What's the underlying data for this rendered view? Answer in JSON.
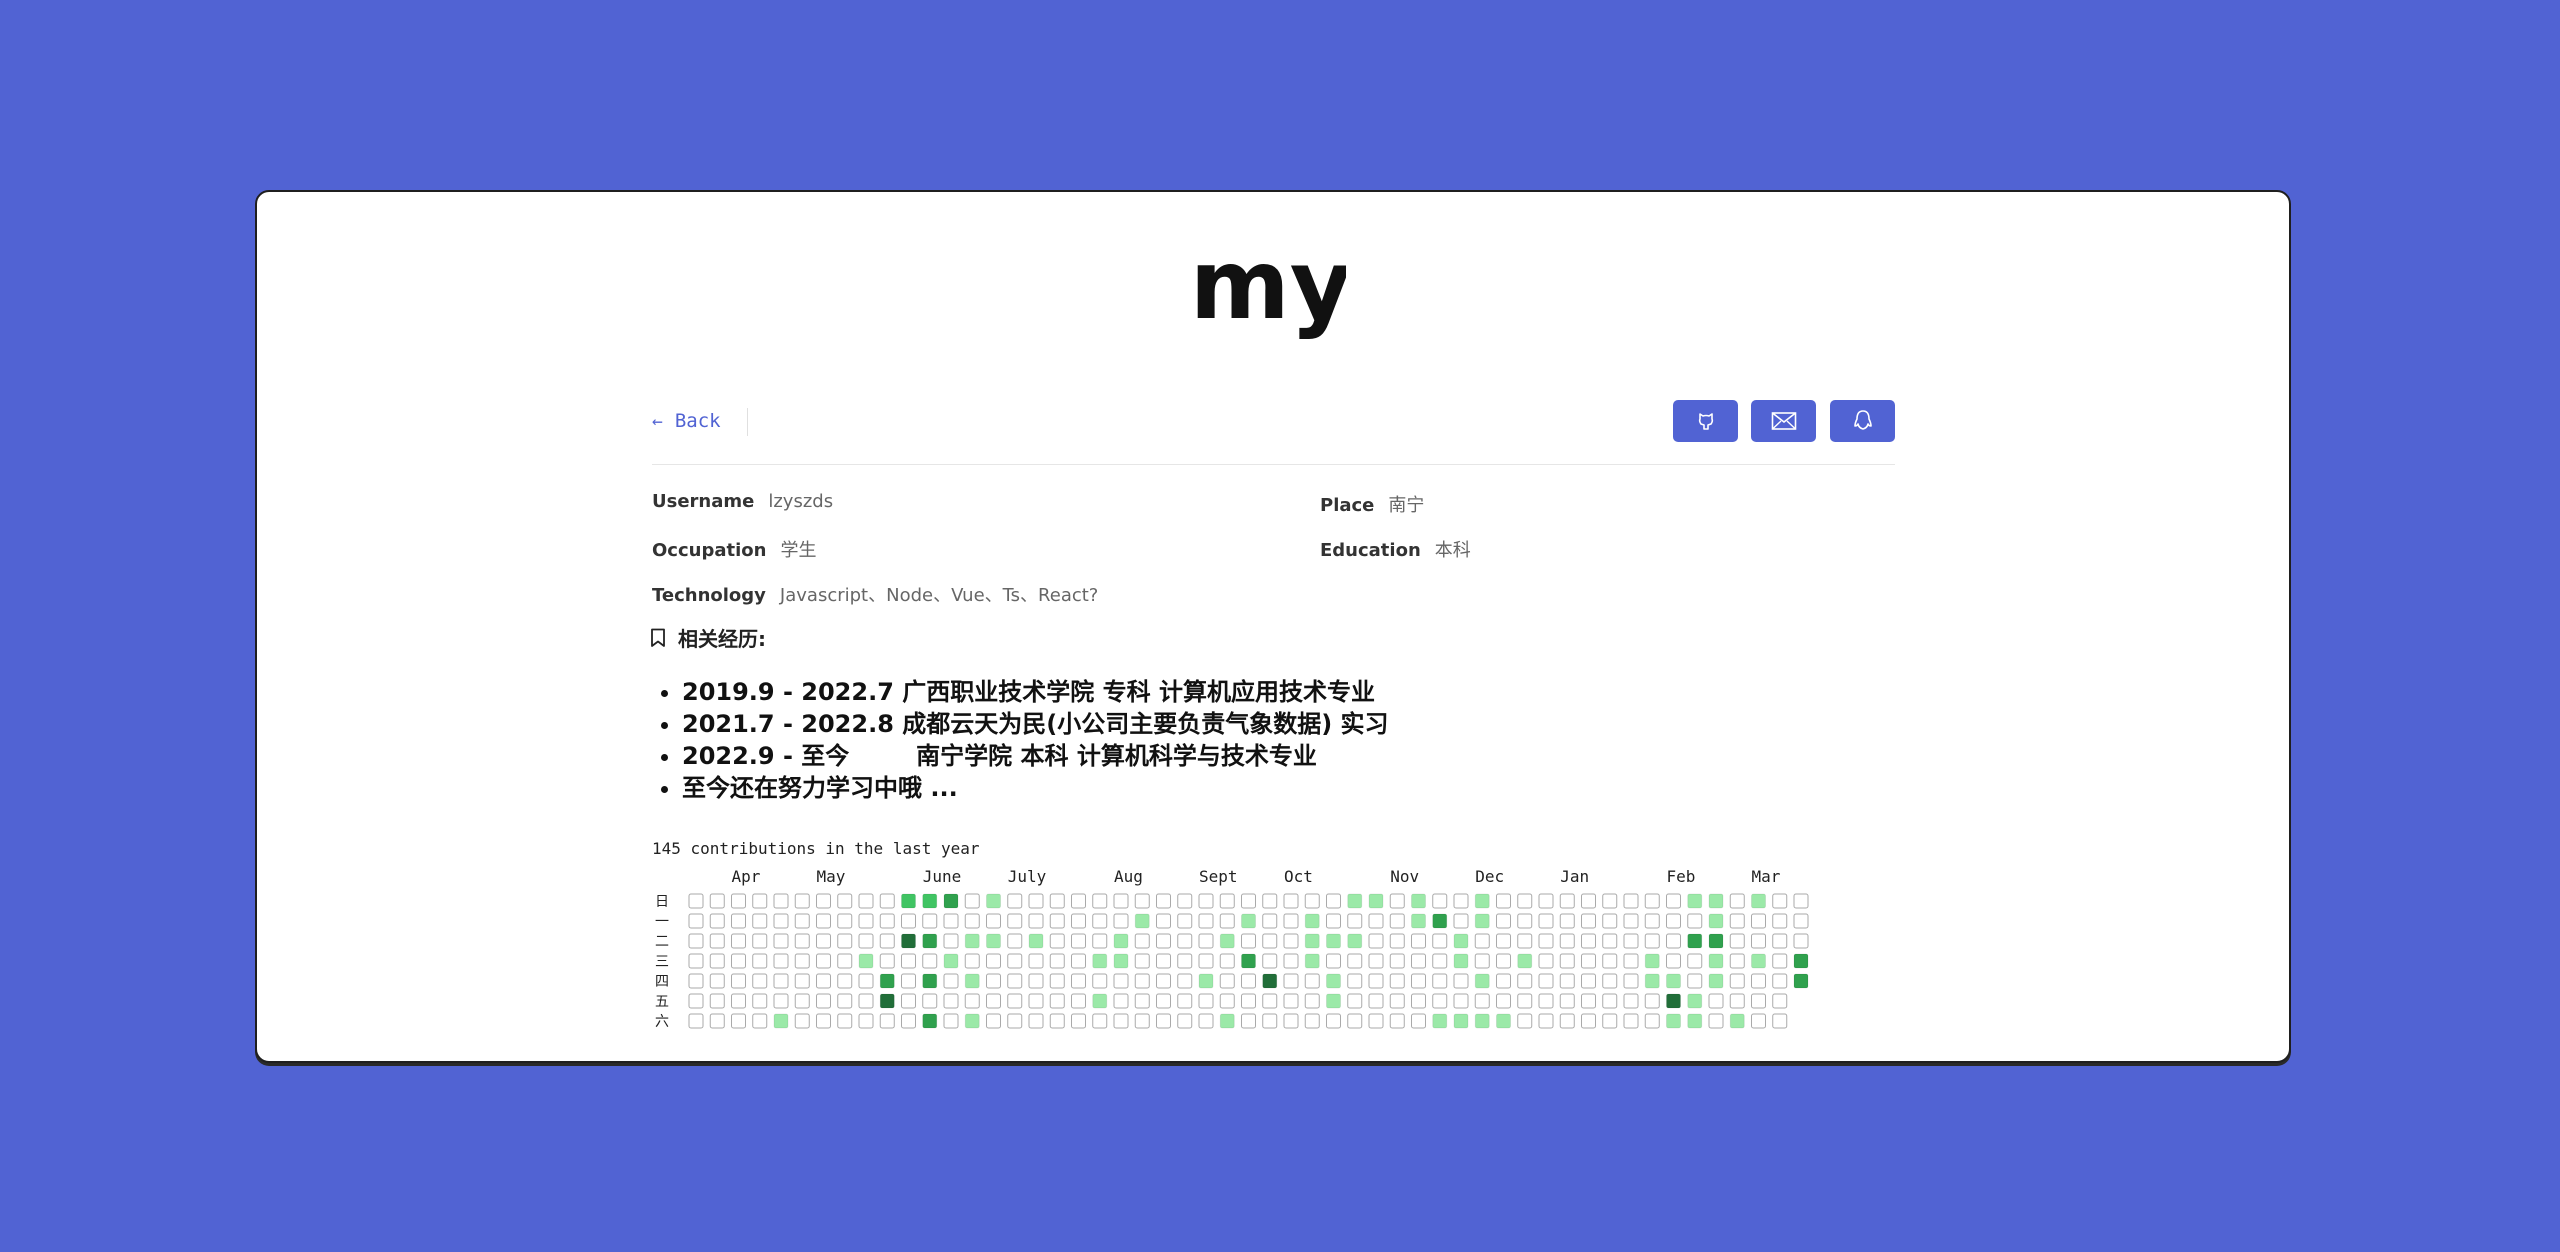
{
  "page": {
    "background": "#5163d3",
    "accent": "#5163d3"
  },
  "header": {
    "logo_text": "my"
  },
  "nav": {
    "back_label": "Back",
    "icons": [
      "github-icon",
      "mail-icon",
      "qq-icon"
    ]
  },
  "profile": {
    "username": {
      "label": "Username",
      "value": "lzyszds"
    },
    "place": {
      "label": "Place",
      "value": "南宁"
    },
    "occupation": {
      "label": "Occupation",
      "value": "学生"
    },
    "education": {
      "label": "Education",
      "value": "本科"
    },
    "technology": {
      "label": "Technology",
      "value": "Javascript、Node、Vue、Ts、React?"
    }
  },
  "experience": {
    "title": "相关经历:",
    "items": [
      "2019.9 - 2022.7 广西职业技术学院 专科 计算机应用技术专业",
      "2021.7 - 2022.8 成都云天为民(小公司主要负责气象数据) 实习",
      "2022.9 - 至今        南宁学院 本科 计算机科学与技术专业",
      "至今还在努力学习中哦 ..."
    ]
  },
  "contributions": {
    "total_text": "145 contributions in the last year",
    "months": [
      "Apr",
      "May",
      "June",
      "July",
      "Aug",
      "Sept",
      "Oct",
      "Nov",
      "Dec",
      "Jan",
      "Feb",
      "Mar"
    ],
    "month_week_index": [
      2,
      6,
      11,
      15,
      20,
      24,
      28,
      33,
      37,
      41,
      46,
      50
    ],
    "weekdays": [
      "日",
      "一",
      "二",
      "三",
      "四",
      "五",
      "六"
    ],
    "colors": [
      "#ebedf0",
      "#9be9a8",
      "#40c463",
      "#30a14e",
      "#216e39"
    ],
    "cells": [
      [
        10,
        0,
        2
      ],
      [
        11,
        0,
        2
      ],
      [
        12,
        0,
        3
      ],
      [
        14,
        0,
        1
      ],
      [
        31,
        0,
        1
      ],
      [
        32,
        0,
        1
      ],
      [
        34,
        0,
        1
      ],
      [
        37,
        0,
        1
      ],
      [
        47,
        0,
        1
      ],
      [
        48,
        0,
        1
      ],
      [
        50,
        0,
        1
      ],
      [
        21,
        1,
        1
      ],
      [
        26,
        1,
        1
      ],
      [
        29,
        1,
        1
      ],
      [
        34,
        1,
        1
      ],
      [
        35,
        1,
        3
      ],
      [
        37,
        1,
        1
      ],
      [
        48,
        1,
        1
      ],
      [
        10,
        2,
        4
      ],
      [
        11,
        2,
        3
      ],
      [
        13,
        2,
        1
      ],
      [
        14,
        2,
        1
      ],
      [
        16,
        2,
        1
      ],
      [
        20,
        2,
        1
      ],
      [
        25,
        2,
        1
      ],
      [
        29,
        2,
        1
      ],
      [
        30,
        2,
        1
      ],
      [
        31,
        2,
        1
      ],
      [
        36,
        2,
        1
      ],
      [
        47,
        2,
        3
      ],
      [
        48,
        2,
        3
      ],
      [
        8,
        3,
        1
      ],
      [
        12,
        3,
        1
      ],
      [
        19,
        3,
        1
      ],
      [
        20,
        3,
        1
      ],
      [
        26,
        3,
        3
      ],
      [
        29,
        3,
        1
      ],
      [
        36,
        3,
        1
      ],
      [
        39,
        3,
        1
      ],
      [
        45,
        3,
        1
      ],
      [
        48,
        3,
        1
      ],
      [
        50,
        3,
        1
      ],
      [
        52,
        3,
        3
      ],
      [
        9,
        4,
        3
      ],
      [
        11,
        4,
        3
      ],
      [
        13,
        4,
        1
      ],
      [
        24,
        4,
        1
      ],
      [
        27,
        4,
        4
      ],
      [
        30,
        4,
        1
      ],
      [
        37,
        4,
        1
      ],
      [
        45,
        4,
        1
      ],
      [
        46,
        4,
        1
      ],
      [
        48,
        4,
        1
      ],
      [
        52,
        4,
        3
      ],
      [
        9,
        5,
        4
      ],
      [
        19,
        5,
        1
      ],
      [
        30,
        5,
        1
      ],
      [
        46,
        5,
        4
      ],
      [
        47,
        5,
        1
      ],
      [
        4,
        6,
        1
      ],
      [
        11,
        6,
        3
      ],
      [
        13,
        6,
        1
      ],
      [
        25,
        6,
        1
      ],
      [
        35,
        6,
        1
      ],
      [
        36,
        6,
        1
      ],
      [
        37,
        6,
        1
      ],
      [
        38,
        6,
        1
      ],
      [
        46,
        6,
        1
      ],
      [
        47,
        6,
        1
      ],
      [
        49,
        6,
        1
      ]
    ]
  }
}
